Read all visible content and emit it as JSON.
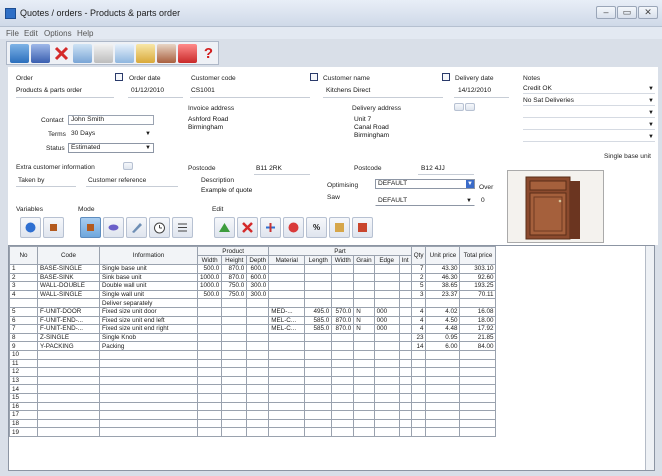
{
  "window": {
    "title": "Quotes / orders - Products & parts order"
  },
  "menu": [
    "File",
    "Edit",
    "Options",
    "Help"
  ],
  "order": {
    "order_label": "Order",
    "order_value": "Products & parts order",
    "order_date_label": "Order date",
    "order_date": "01/12/2010",
    "customer_code_label": "Customer code",
    "customer_code": "CS1001",
    "customer_name_label": "Customer name",
    "customer_name": "Kitchens Direct",
    "delivery_date_label": "Delivery date",
    "delivery_date": "14/12/2010",
    "contact_label": "Contact",
    "contact": "John Smith",
    "terms_label": "Terms",
    "terms": "30 Days",
    "status_label": "Status",
    "status": "Estimated",
    "invoice_address_label": "Invoice address",
    "invoice_address": [
      "Ashford Road",
      "Birmingham"
    ],
    "delivery_address_label": "Delivery address",
    "delivery_address": [
      "Unit 7",
      "Canal Road",
      "Birmingham"
    ],
    "extra_info_label": "Extra customer information",
    "taken_by_label": "Taken by",
    "customer_reference_label": "Customer reference",
    "invoice_postcode_label": "Postcode",
    "invoice_postcode": "B11 2RK",
    "delivery_postcode_label": "Postcode",
    "delivery_postcode": "B12 4JJ",
    "description_label": "Description",
    "description": "Example of quote",
    "optimising_label": "Optimising",
    "optimising": "DEFAULT",
    "saw_label": "Saw",
    "saw": "DEFAULT",
    "over_label": "Over",
    "over_value": "0"
  },
  "notes": {
    "label": "Notes",
    "items": [
      "Credit OK",
      "No Sat Deliveries",
      "",
      "",
      ""
    ],
    "product_caption": "Single base unit"
  },
  "sections": {
    "variables": "Variables",
    "mode": "Mode",
    "edit": "Edit"
  },
  "table": {
    "group_product": "Product",
    "group_part": "Part",
    "headers": [
      "No",
      "Code",
      "Information",
      "Width",
      "Height",
      "Depth",
      "Material",
      "Length",
      "Width",
      "Grain",
      "Edge",
      "Int",
      "Qty",
      "Unit price",
      "Total price"
    ],
    "rows": [
      [
        "1",
        "BASE-SINGLE",
        "Single base unit",
        "500.0",
        "870.0",
        "600.0",
        "",
        "",
        "",
        "",
        "",
        "",
        "7",
        "43.30",
        "303.10"
      ],
      [
        "2",
        "BASE-SINK",
        "Sink base unit",
        "1000.0",
        "870.0",
        "600.0",
        "",
        "",
        "",
        "",
        "",
        "",
        "2",
        "46.30",
        "92.60"
      ],
      [
        "3",
        "WALL-DOUBLE",
        "Double wall unit",
        "1000.0",
        "750.0",
        "300.0",
        "",
        "",
        "",
        "",
        "",
        "",
        "5",
        "38.65",
        "193.25"
      ],
      [
        "4",
        "WALL-SINGLE",
        "Single wall unit",
        "500.0",
        "750.0",
        "300.0",
        "",
        "",
        "",
        "",
        "",
        "",
        "3",
        "23.37",
        "70.11"
      ],
      [
        "",
        "",
        "Deliver separately",
        "",
        "",
        "",
        "",
        "",
        "",
        "",
        "",
        "",
        "",
        "",
        ""
      ],
      [
        "5",
        "F-UNIT-DOOR",
        "Fixed size unit door",
        "",
        "",
        "",
        "MED-...",
        "495.0",
        "570.0",
        "N",
        "000",
        "",
        "4",
        "4.02",
        "16.08"
      ],
      [
        "6",
        "F-UNIT-END-...",
        "Fixed size unit end left",
        "",
        "",
        "",
        "MEL-C...",
        "585.0",
        "870.0",
        "N",
        "000",
        "",
        "4",
        "4.50",
        "18.00"
      ],
      [
        "7",
        "F-UNIT-END-...",
        "Fixed size unit end right",
        "",
        "",
        "",
        "MEL-C...",
        "585.0",
        "870.0",
        "N",
        "000",
        "",
        "4",
        "4.48",
        "17.92"
      ],
      [
        "8",
        "Z-SINGLE",
        "Single Knob",
        "",
        "",
        "",
        "",
        "",
        "",
        "",
        "",
        "",
        "23",
        "0.95",
        "21.85"
      ],
      [
        "9",
        "Y-PACKING",
        "Packing",
        "",
        "",
        "",
        "",
        "",
        "",
        "",
        "",
        "",
        "14",
        "6.00",
        "84.00"
      ],
      [
        "10",
        "",
        "",
        "",
        "",
        "",
        "",
        "",
        "",
        "",
        "",
        "",
        "",
        "",
        ""
      ],
      [
        "11",
        "",
        "",
        "",
        "",
        "",
        "",
        "",
        "",
        "",
        "",
        "",
        "",
        "",
        ""
      ],
      [
        "12",
        "",
        "",
        "",
        "",
        "",
        "",
        "",
        "",
        "",
        "",
        "",
        "",
        "",
        ""
      ],
      [
        "13",
        "",
        "",
        "",
        "",
        "",
        "",
        "",
        "",
        "",
        "",
        "",
        "",
        "",
        ""
      ],
      [
        "14",
        "",
        "",
        "",
        "",
        "",
        "",
        "",
        "",
        "",
        "",
        "",
        "",
        "",
        ""
      ],
      [
        "15",
        "",
        "",
        "",
        "",
        "",
        "",
        "",
        "",
        "",
        "",
        "",
        "",
        "",
        ""
      ],
      [
        "16",
        "",
        "",
        "",
        "",
        "",
        "",
        "",
        "",
        "",
        "",
        "",
        "",
        "",
        ""
      ],
      [
        "17",
        "",
        "",
        "",
        "",
        "",
        "",
        "",
        "",
        "",
        "",
        "",
        "",
        "",
        ""
      ],
      [
        "18",
        "",
        "",
        "",
        "",
        "",
        "",
        "",
        "",
        "",
        "",
        "",
        "",
        "",
        ""
      ],
      [
        "19",
        "",
        "",
        "",
        "",
        "",
        "",
        "",
        "",
        "",
        "",
        "",
        "",
        "",
        ""
      ]
    ]
  }
}
